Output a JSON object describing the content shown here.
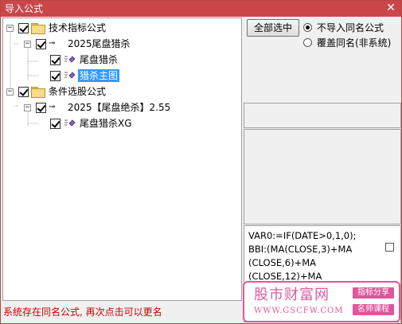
{
  "window": {
    "title": "导入公式",
    "close_glyph": "✕"
  },
  "tree": {
    "nodes": [
      {
        "label": "技术指标公式",
        "type": "folder",
        "checked": true,
        "expanded": true
      },
      {
        "label": "2025尾盘猎杀",
        "type": "group",
        "checked": true,
        "expanded": true
      },
      {
        "label": "尾盘猎杀",
        "type": "formula",
        "checked": true
      },
      {
        "label": "猎杀主图",
        "type": "formula",
        "checked": true,
        "selected": true
      },
      {
        "label": "条件选股公式",
        "type": "folder",
        "checked": true,
        "expanded": true
      },
      {
        "label": "2025【尾盘绝杀】2.55",
        "type": "group",
        "checked": true,
        "expanded": true
      },
      {
        "label": "尾盘猎杀XG",
        "type": "formula",
        "checked": true
      }
    ],
    "expander_glyph": "−",
    "key_glyph": "⊸"
  },
  "options": {
    "select_all_label": "全部选中",
    "radio_no_import": "不导入同名公式",
    "radio_overwrite": "覆盖同名(非系统)"
  },
  "code_preview": [
    "VAR0:=IF(DATE>0,1,0);",
    "BBI:(MA(CLOSE,3)+MA",
    "(CLOSE,6)+MA",
    "(CLOSE,12)+MA"
  ],
  "watermark": {
    "brand": "股市财富网",
    "url": "WWW.GSCFW.COM",
    "tag1": "指标分享",
    "tag2": "名师课程"
  },
  "status_text": "系统存在同名公式, 再次点击可以更名",
  "colors": {
    "title_bar": "#c9474b",
    "selection": "#3399ff",
    "status": "#cc0000",
    "watermark": "#e0569a"
  }
}
